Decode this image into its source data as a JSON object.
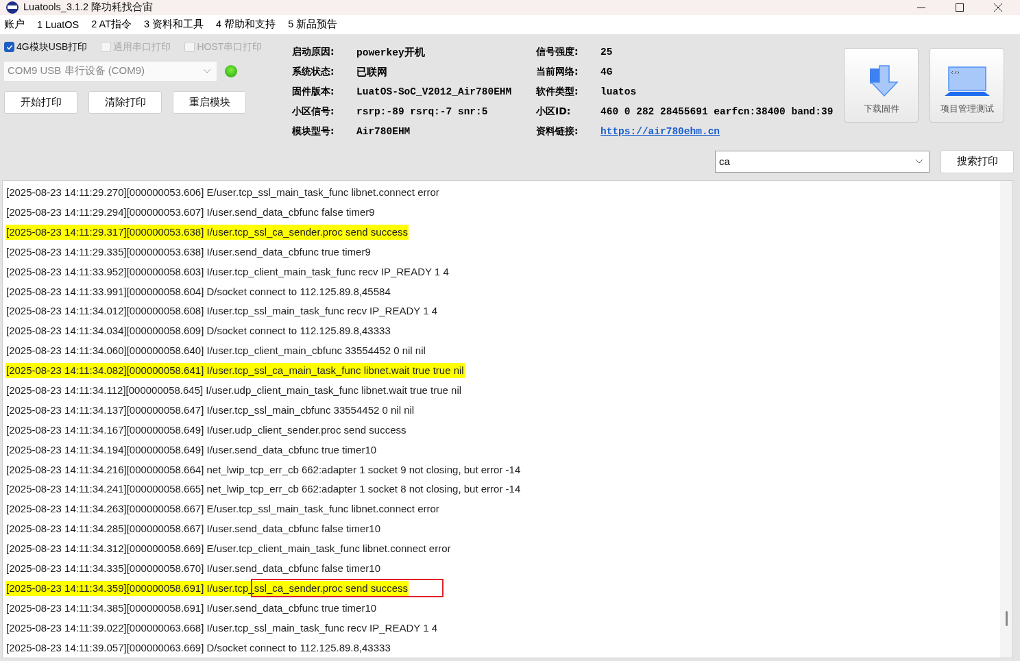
{
  "window": {
    "title": "Luatools_3.1.2 降功耗找合宙"
  },
  "menu": [
    "账户",
    "1 LuatOS",
    "2 AT指令",
    "3 资料和工具",
    "4 帮助和支持",
    "5 新品预告"
  ],
  "print_options": [
    {
      "label": "4G模块USB打印",
      "checked": true,
      "disabled": false
    },
    {
      "label": "通用串口打印",
      "checked": false,
      "disabled": true
    },
    {
      "label": "HOST串口打印",
      "checked": false,
      "disabled": true
    }
  ],
  "port": {
    "value": "COM9 USB 串行设备 (COM9)",
    "connected": true
  },
  "buttons": [
    "开始打印",
    "清除打印",
    "重启模块"
  ],
  "info_left": [
    {
      "label": "启动原因:",
      "value": "powerkey开机"
    },
    {
      "label": "系统状态:",
      "value": "已联网"
    },
    {
      "label": "固件版本:",
      "value": "LuatOS-SoC_V2012_Air780EHM"
    },
    {
      "label": "小区信号:",
      "value": "rsrp:-89 rsrq:-7 snr:5"
    },
    {
      "label": "模块型号:",
      "value": "Air780EHM"
    }
  ],
  "info_right": [
    {
      "label": "信号强度:",
      "value": "25",
      "kind": "text"
    },
    {
      "label": "当前网络:",
      "value": "4G",
      "kind": "text"
    },
    {
      "label": "软件类型:",
      "value": "luatos",
      "kind": "text"
    },
    {
      "label": "小区ID:",
      "value": "460 0 282 28455691 earfcn:38400 band:39",
      "kind": "text"
    },
    {
      "label": "资料链接:",
      "value": "https://air780ehm.cn",
      "kind": "link"
    }
  ],
  "tools": [
    {
      "label": "下载固件",
      "kind": "download"
    },
    {
      "label": "项目管理测试",
      "kind": "laptop"
    }
  ],
  "search": {
    "value": "ca",
    "button": "搜索打印"
  },
  "log": [
    {
      "text": "[2025-08-23 14:11:29.270][000000053.606] E/user.tcp_ssl_main_task_func libnet.connect error",
      "highlighted": false,
      "boxed": false
    },
    {
      "text": "[2025-08-23 14:11:29.294][000000053.607] I/user.send_data_cbfunc false timer9",
      "highlighted": false,
      "boxed": false
    },
    {
      "text": "[2025-08-23 14:11:29.317][000000053.638] I/user.tcp_ssl_ca_sender.proc send success",
      "highlighted": true,
      "boxed": false
    },
    {
      "text": "[2025-08-23 14:11:29.335][000000053.638] I/user.send_data_cbfunc true timer9",
      "highlighted": false,
      "boxed": false
    },
    {
      "text": "[2025-08-23 14:11:33.952][000000058.603] I/user.tcp_client_main_task_func recv IP_READY 1 4",
      "highlighted": false,
      "boxed": false
    },
    {
      "text": "[2025-08-23 14:11:33.991][000000058.604] D/socket connect to 112.125.89.8,45584",
      "highlighted": false,
      "boxed": false
    },
    {
      "text": "[2025-08-23 14:11:34.012][000000058.608] I/user.tcp_ssl_main_task_func recv IP_READY 1 4",
      "highlighted": false,
      "boxed": false
    },
    {
      "text": "[2025-08-23 14:11:34.034][000000058.609] D/socket connect to 112.125.89.8,43333",
      "highlighted": false,
      "boxed": false
    },
    {
      "text": "[2025-08-23 14:11:34.060][000000058.640] I/user.tcp_client_main_cbfunc 33554452 0 nil nil",
      "highlighted": false,
      "boxed": false
    },
    {
      "text": "[2025-08-23 14:11:34.082][000000058.641] I/user.tcp_ssl_ca_main_task_func libnet.wait true true nil",
      "highlighted": true,
      "boxed": false
    },
    {
      "text": "[2025-08-23 14:11:34.112][000000058.645] I/user.udp_client_main_task_func libnet.wait true true nil",
      "highlighted": false,
      "boxed": false
    },
    {
      "text": "[2025-08-23 14:11:34.137][000000058.647] I/user.tcp_ssl_main_cbfunc 33554452 0 nil nil",
      "highlighted": false,
      "boxed": false
    },
    {
      "text": "[2025-08-23 14:11:34.167][000000058.649] I/user.udp_client_sender.proc send success",
      "highlighted": false,
      "boxed": false
    },
    {
      "text": "[2025-08-23 14:11:34.194][000000058.649] I/user.send_data_cbfunc true timer10",
      "highlighted": false,
      "boxed": false
    },
    {
      "text": "[2025-08-23 14:11:34.216][000000058.664] net_lwip_tcp_err_cb 662:adapter 1 socket 9 not closing, but error -14",
      "highlighted": false,
      "boxed": false
    },
    {
      "text": "[2025-08-23 14:11:34.241][000000058.665] net_lwip_tcp_err_cb 662:adapter 1 socket 8 not closing, but error -14",
      "highlighted": false,
      "boxed": false
    },
    {
      "text": "[2025-08-23 14:11:34.263][000000058.667] E/user.tcp_ssl_main_task_func libnet.connect error",
      "highlighted": false,
      "boxed": false
    },
    {
      "text": "[2025-08-23 14:11:34.285][000000058.667] I/user.send_data_cbfunc false timer10",
      "highlighted": false,
      "boxed": false
    },
    {
      "text": "[2025-08-23 14:11:34.312][000000058.669] E/user.tcp_client_main_task_func libnet.connect error",
      "highlighted": false,
      "boxed": false
    },
    {
      "text": "[2025-08-23 14:11:34.335][000000058.670] I/user.send_data_cbfunc false timer10",
      "highlighted": false,
      "boxed": false
    },
    {
      "text": "[2025-08-23 14:11:34.359][000000058.691] I/user.tcp_ssl_ca_sender.proc send success",
      "highlighted": true,
      "boxed": true
    },
    {
      "text": "[2025-08-23 14:11:34.385][000000058.691] I/user.send_data_cbfunc true timer10",
      "highlighted": false,
      "boxed": false
    },
    {
      "text": "[2025-08-23 14:11:39.022][000000063.668] I/user.tcp_ssl_main_task_func recv IP_READY 1 4",
      "highlighted": false,
      "boxed": false
    },
    {
      "text": "[2025-08-23 14:11:39.057][000000063.669] D/socket connect to 112.125.89.8,43333",
      "highlighted": false,
      "boxed": false
    }
  ]
}
